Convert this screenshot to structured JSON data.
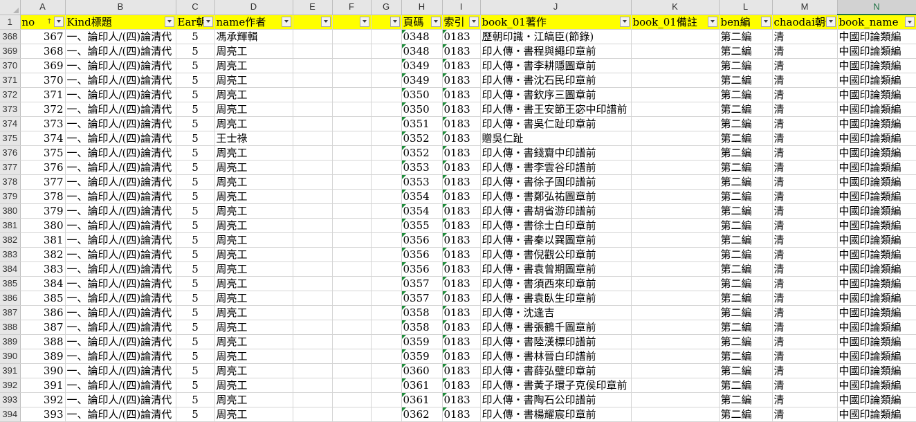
{
  "columns": [
    "A",
    "B",
    "C",
    "D",
    "E",
    "F",
    "G",
    "H",
    "I",
    "J",
    "K",
    "L",
    "M",
    "N"
  ],
  "selected_column": "N",
  "header_row_number": "1",
  "headers": [
    "no",
    "Kind標題",
    "Ear朝",
    "name作者",
    "",
    "",
    "",
    "頁碼",
    "索引",
    "book_01著作",
    "book_01備註",
    "ben編",
    "chaodai朝代",
    "book_name"
  ],
  "rows": [
    {
      "r": "368",
      "c": [
        "367",
        "一、論印人/(四)論清代",
        "5",
        "馮承輝輯",
        "",
        "",
        "",
        "0348",
        "0183",
        "歷朝印識・江皜臣(節錄)",
        "",
        "第二編",
        "清",
        "中國印論類編"
      ]
    },
    {
      "r": "369",
      "c": [
        "368",
        "一、論印人/(四)論清代",
        "5",
        "周亮工",
        "",
        "",
        "",
        "0348",
        "0183",
        "印人傳・書程與繩印章前",
        "",
        "第二編",
        "清",
        "中國印論類編"
      ]
    },
    {
      "r": "370",
      "c": [
        "369",
        "一、論印人/(四)論清代",
        "5",
        "周亮工",
        "",
        "",
        "",
        "0349",
        "0183",
        "印人傳・書李耕隱圖章前",
        "",
        "第二編",
        "清",
        "中國印論類編"
      ]
    },
    {
      "r": "371",
      "c": [
        "370",
        "一、論印人/(四)論清代",
        "5",
        "周亮工",
        "",
        "",
        "",
        "0349",
        "0183",
        "印人傳・書沈石民印章前",
        "",
        "第二編",
        "清",
        "中國印論類編"
      ]
    },
    {
      "r": "372",
      "c": [
        "371",
        "一、論印人/(四)論清代",
        "5",
        "周亮工",
        "",
        "",
        "",
        "0350",
        "0183",
        "印人傳・書欽序三圖章前",
        "",
        "第二編",
        "清",
        "中國印論類編"
      ]
    },
    {
      "r": "373",
      "c": [
        "372",
        "一、論印人/(四)論清代",
        "5",
        "周亮工",
        "",
        "",
        "",
        "0350",
        "0183",
        "印人傳・書王安節王宓中印譜前",
        "",
        "第二編",
        "清",
        "中國印論類編"
      ]
    },
    {
      "r": "374",
      "c": [
        "373",
        "一、論印人/(四)論清代",
        "5",
        "周亮工",
        "",
        "",
        "",
        "0351",
        "0183",
        "印人傳・書吳仁趾印章前",
        "",
        "第二編",
        "清",
        "中國印論類編"
      ]
    },
    {
      "r": "375",
      "c": [
        "374",
        "一、論印人/(四)論清代",
        "5",
        "王士祿",
        "",
        "",
        "",
        "0352",
        "0183",
        "贈吳仁趾",
        "",
        "第二編",
        "清",
        "中國印論類編"
      ]
    },
    {
      "r": "376",
      "c": [
        "375",
        "一、論印人/(四)論清代",
        "5",
        "周亮工",
        "",
        "",
        "",
        "0352",
        "0183",
        "印人傳・書錢齎中印譜前",
        "",
        "第二編",
        "清",
        "中國印論類編"
      ]
    },
    {
      "r": "377",
      "c": [
        "376",
        "一、論印人/(四)論清代",
        "5",
        "周亮工",
        "",
        "",
        "",
        "0353",
        "0183",
        "印人傳・書李雲谷印譜前",
        "",
        "第二編",
        "清",
        "中國印論類編"
      ]
    },
    {
      "r": "378",
      "c": [
        "377",
        "一、論印人/(四)論清代",
        "5",
        "周亮工",
        "",
        "",
        "",
        "0353",
        "0183",
        "印人傳・書徐子固印譜前",
        "",
        "第二編",
        "清",
        "中國印論類編"
      ]
    },
    {
      "r": "379",
      "c": [
        "378",
        "一、論印人/(四)論清代",
        "5",
        "周亮工",
        "",
        "",
        "",
        "0354",
        "0183",
        "印人傳・書鄭弘祐圖章前",
        "",
        "第二編",
        "清",
        "中國印論類編"
      ]
    },
    {
      "r": "380",
      "c": [
        "379",
        "一、論印人/(四)論清代",
        "5",
        "周亮工",
        "",
        "",
        "",
        "0354",
        "0183",
        "印人傳・書胡省游印譜前",
        "",
        "第二編",
        "清",
        "中國印論類編"
      ]
    },
    {
      "r": "381",
      "c": [
        "380",
        "一、論印人/(四)論清代",
        "5",
        "周亮工",
        "",
        "",
        "",
        "0355",
        "0183",
        "印人傳・書徐士白印章前",
        "",
        "第二編",
        "清",
        "中國印論類編"
      ]
    },
    {
      "r": "382",
      "c": [
        "381",
        "一、論印人/(四)論清代",
        "5",
        "周亮工",
        "",
        "",
        "",
        "0356",
        "0183",
        "印人傳・書秦以巽圖章前",
        "",
        "第二編",
        "清",
        "中國印論類編"
      ]
    },
    {
      "r": "383",
      "c": [
        "382",
        "一、論印人/(四)論清代",
        "5",
        "周亮工",
        "",
        "",
        "",
        "0356",
        "0183",
        "印人傳・書倪觀公印章前",
        "",
        "第二編",
        "清",
        "中國印論類編"
      ]
    },
    {
      "r": "384",
      "c": [
        "383",
        "一、論印人/(四)論清代",
        "5",
        "周亮工",
        "",
        "",
        "",
        "0356",
        "0183",
        "印人傳・書袁曾期圖章前",
        "",
        "第二編",
        "清",
        "中國印論類編"
      ]
    },
    {
      "r": "385",
      "c": [
        "384",
        "一、論印人/(四)論清代",
        "5",
        "周亮工",
        "",
        "",
        "",
        "0357",
        "0183",
        "印人傳・書須西來印章前",
        "",
        "第二編",
        "清",
        "中國印論類編"
      ]
    },
    {
      "r": "386",
      "c": [
        "385",
        "一、論印人/(四)論清代",
        "5",
        "周亮工",
        "",
        "",
        "",
        "0357",
        "0183",
        "印人傳・書袁臥生印章前",
        "",
        "第二編",
        "清",
        "中國印論類編"
      ]
    },
    {
      "r": "387",
      "c": [
        "386",
        "一、論印人/(四)論清代",
        "5",
        "周亮工",
        "",
        "",
        "",
        "0358",
        "0183",
        "印人傳・沈逢吉",
        "",
        "第二編",
        "清",
        "中國印論類編"
      ]
    },
    {
      "r": "388",
      "c": [
        "387",
        "一、論印人/(四)論清代",
        "5",
        "周亮工",
        "",
        "",
        "",
        "0358",
        "0183",
        "印人傳・書張鶴千圖章前",
        "",
        "第二編",
        "清",
        "中國印論類編"
      ]
    },
    {
      "r": "389",
      "c": [
        "388",
        "一、論印人/(四)論清代",
        "5",
        "周亮工",
        "",
        "",
        "",
        "0359",
        "0183",
        "印人傳・書陸漢標印譜前",
        "",
        "第二編",
        "清",
        "中國印論類編"
      ]
    },
    {
      "r": "390",
      "c": [
        "389",
        "一、論印人/(四)論清代",
        "5",
        "周亮工",
        "",
        "",
        "",
        "0359",
        "0183",
        "印人傳・書林晉白印譜前",
        "",
        "第二編",
        "清",
        "中國印論類編"
      ]
    },
    {
      "r": "391",
      "c": [
        "390",
        "一、論印人/(四)論清代",
        "5",
        "周亮工",
        "",
        "",
        "",
        "0360",
        "0183",
        "印人傳・書薛弘璧印章前",
        "",
        "第二編",
        "清",
        "中國印論類編"
      ]
    },
    {
      "r": "392",
      "c": [
        "391",
        "一、論印人/(四)論清代",
        "5",
        "周亮工",
        "",
        "",
        "",
        "0361",
        "0183",
        "印人傳・書黃子環子克侯印章前",
        "",
        "第二編",
        "清",
        "中國印論類編"
      ]
    },
    {
      "r": "393",
      "c": [
        "392",
        "一、論印人/(四)論清代",
        "5",
        "周亮工",
        "",
        "",
        "",
        "0361",
        "0183",
        "印人傳・書陶石公印譜前",
        "",
        "第二編",
        "清",
        "中國印論類編"
      ]
    },
    {
      "r": "394",
      "c": [
        "393",
        "一、論印人/(四)論清代",
        "5",
        "周亮工",
        "",
        "",
        "",
        "0362",
        "0183",
        "印人傳・書楊耀宸印章前",
        "",
        "第二編",
        "清",
        "中國印論類編"
      ]
    }
  ]
}
